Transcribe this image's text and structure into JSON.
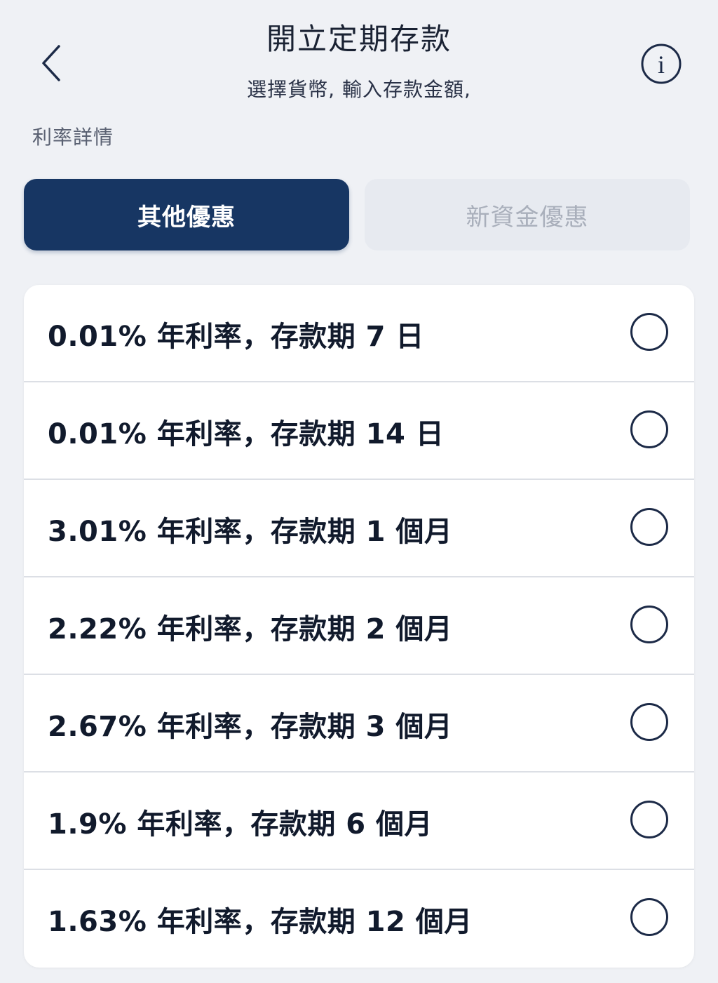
{
  "header": {
    "title": "開立定期存款",
    "subtitle": "選擇貨幣, 輸入存款金額,",
    "back_icon": "chevron-left-icon",
    "info_icon": "info-circle-icon",
    "info_glyph": "i"
  },
  "section_label": "利率詳情",
  "tabs": [
    {
      "label": "其他優惠",
      "active": true
    },
    {
      "label": "新資金優惠",
      "active": false
    }
  ],
  "colors": {
    "background": "#eff1f5",
    "primary": "#173663",
    "inactive_tab": "#e7eaf0",
    "inactive_text": "#a9afbb"
  },
  "options": [
    {
      "label": "0.01% 年利率，存款期 7 日",
      "selected": false
    },
    {
      "label": "0.01% 年利率，存款期 14 日",
      "selected": false
    },
    {
      "label": "3.01% 年利率，存款期 1 個月",
      "selected": false
    },
    {
      "label": "2.22% 年利率，存款期 2 個月",
      "selected": false
    },
    {
      "label": "2.67% 年利率，存款期 3 個月",
      "selected": false
    },
    {
      "label": "1.9% 年利率，存款期 6 個月",
      "selected": false
    },
    {
      "label": "1.63% 年利率，存款期 12 個月",
      "selected": false
    }
  ]
}
